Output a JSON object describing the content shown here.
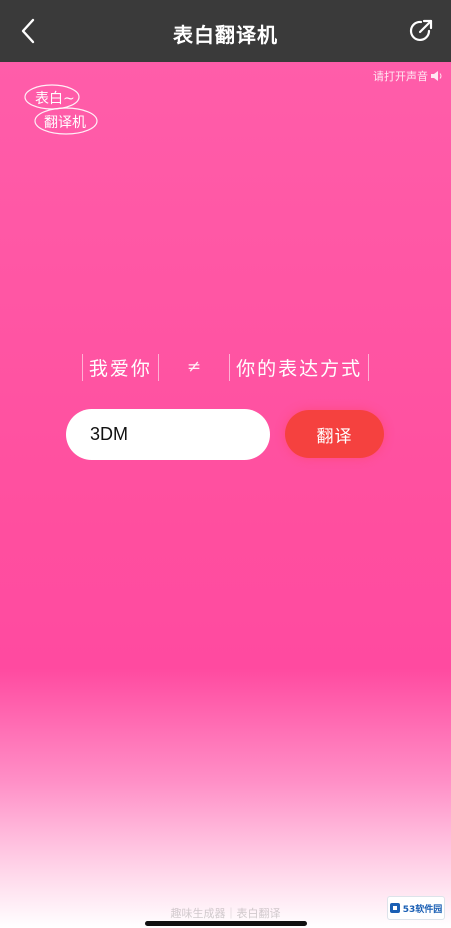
{
  "navbar": {
    "title": "表白翻译机",
    "back_icon": "chevron-left-icon",
    "share_icon": "share-arrow-icon"
  },
  "logo": {
    "line1": "表白~",
    "line2": "翻译机"
  },
  "music": {
    "label": "请打开声音",
    "icon": "speaker-icon"
  },
  "equation": {
    "left": "我爱你",
    "sign": "≠",
    "right": "你的表达方式"
  },
  "input": {
    "value": "3DM",
    "placeholder": ""
  },
  "translate_button": {
    "label": "翻译"
  },
  "footer": {
    "note": "趣味生成器｜表白翻译"
  },
  "watermark": {
    "text": "53软件园"
  },
  "colors": {
    "navbar_bg": "#3a3a3a",
    "background_pink": "#ff5fab",
    "button_red": "#f5413f"
  }
}
